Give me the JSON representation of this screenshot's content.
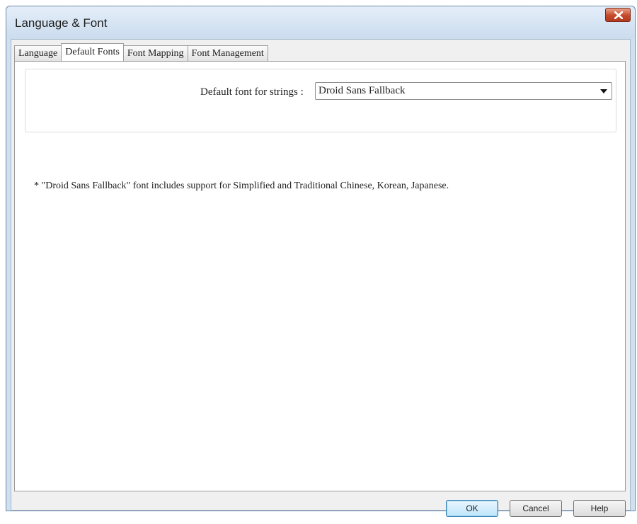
{
  "window": {
    "title": "Language & Font"
  },
  "icons": {
    "close": "close-icon",
    "dropdown": "chevron-down-icon"
  },
  "tabs": [
    {
      "label": "Language"
    },
    {
      "label": "Default Fonts",
      "active": true
    },
    {
      "label": "Font Mapping"
    },
    {
      "label": "Font Management"
    }
  ],
  "default_fonts": {
    "label": "Default font for strings :",
    "selected_font": "Droid Sans Fallback"
  },
  "note": "* \"Droid Sans Fallback\" font includes support for Simplified and Traditional Chinese, Korean, Japanese.",
  "buttons": {
    "ok": "OK",
    "cancel": "Cancel",
    "help": "Help"
  },
  "colors": {
    "close_button": "#c54a2b",
    "title_bar": "#cbdcee",
    "ok_button": "#bee6fd"
  }
}
